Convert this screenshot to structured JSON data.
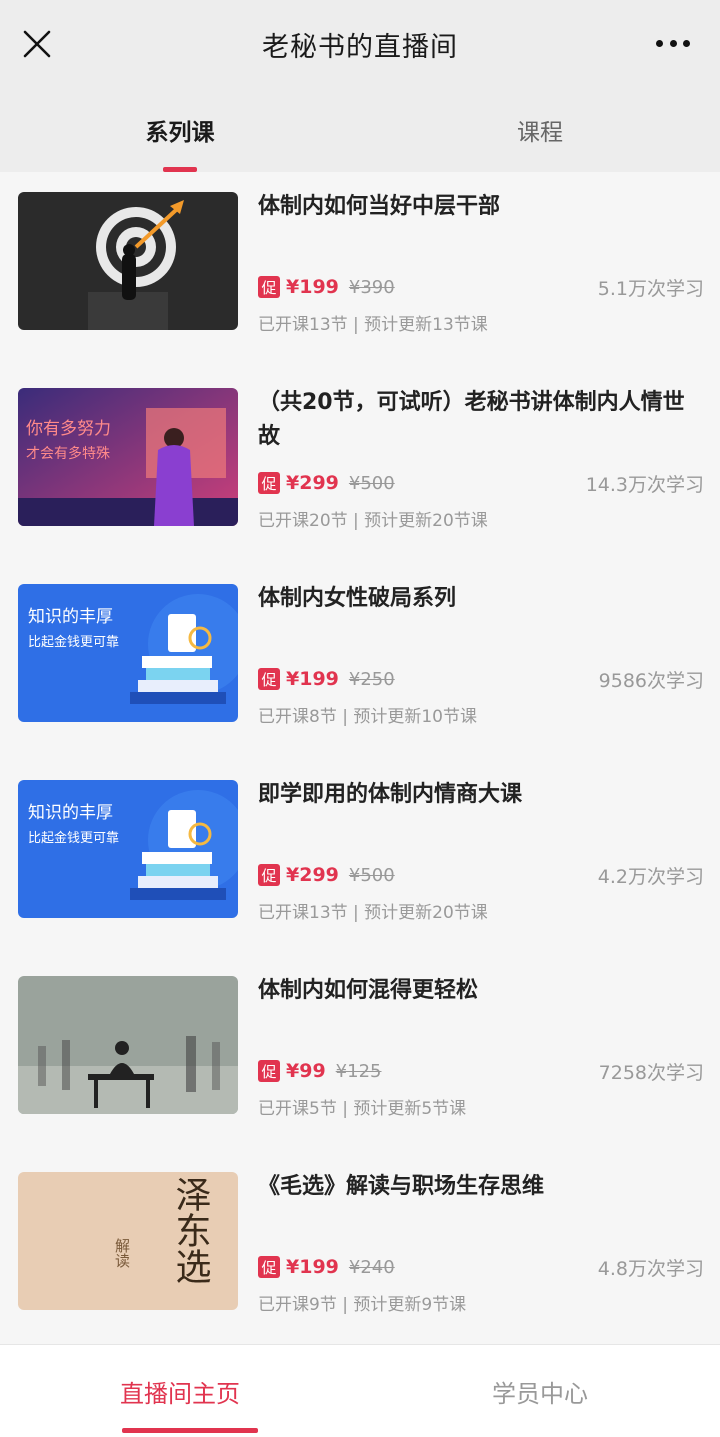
{
  "header": {
    "title": "老秘书的直播间"
  },
  "tabs": [
    {
      "label": "系列课",
      "active": true
    },
    {
      "label": "课程",
      "active": false
    }
  ],
  "promo_label": "促",
  "courses": [
    {
      "title": "体制内如何当好中层干部",
      "price": "¥199",
      "original": "¥390",
      "learners": "5.1万次学习",
      "meta": "已开课13节 | 预计更新13节课"
    },
    {
      "title": "（共20节，可试听）老秘书讲体制内人情世故",
      "price": "¥299",
      "original": "¥500",
      "learners": "14.3万次学习",
      "meta": "已开课20节 | 预计更新20节课",
      "thumb_text": [
        "你有多努力",
        "才会有多特殊"
      ]
    },
    {
      "title": "体制内女性破局系列",
      "price": "¥199",
      "original": "¥250",
      "learners": "9586次学习",
      "meta": "已开课8节 | 预计更新10节课",
      "thumb_text": [
        "知识的丰厚",
        "比起金钱更可靠"
      ]
    },
    {
      "title": "即学即用的体制内情商大课",
      "price": "¥299",
      "original": "¥500",
      "learners": "4.2万次学习",
      "meta": "已开课13节 | 预计更新20节课",
      "thumb_text": [
        "知识的丰厚",
        "比起金钱更可靠"
      ]
    },
    {
      "title": "体制内如何混得更轻松",
      "price": "¥99",
      "original": "¥125",
      "learners": "7258次学习",
      "meta": "已开课5节 | 预计更新5节课"
    },
    {
      "title": "《毛选》解读与职场生存思维",
      "price": "¥199",
      "original": "¥240",
      "learners": "4.8万次学习",
      "meta": "已开课9节 | 预计更新9节课",
      "thumb_text": [
        "解读",
        "泽东选"
      ]
    }
  ],
  "bottom_nav": [
    {
      "label": "直播间主页",
      "active": true
    },
    {
      "label": "学员中心",
      "active": false
    }
  ],
  "colors": {
    "accent": "#e1344f",
    "header_bg": "#ededed"
  }
}
